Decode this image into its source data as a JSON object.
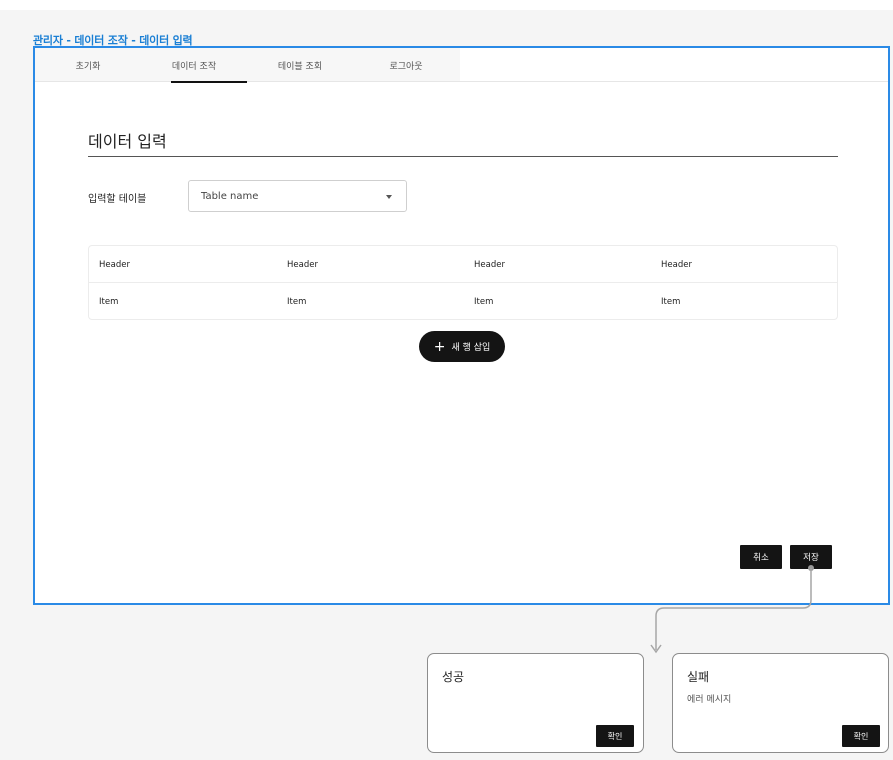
{
  "frame_title": "관리자 - 데이터 조작 - 데이터 입력",
  "tabs": [
    {
      "label": "초기화"
    },
    {
      "label": "데이터 조작"
    },
    {
      "label": "테이블 조회"
    },
    {
      "label": "로그아웃"
    }
  ],
  "active_tab": "데이터 조작",
  "page_heading": "데이터 입력",
  "table_select": {
    "label": "입력할 테이블",
    "value": "Table name"
  },
  "data_table": {
    "headers": [
      "Header",
      "Header",
      "Header",
      "Header"
    ],
    "rows": [
      [
        "Item",
        "Item",
        "Item",
        "Item"
      ]
    ]
  },
  "add_row_button": {
    "icon": "plus-icon",
    "label": "새 행 삽입"
  },
  "actions": {
    "cancel": "취소",
    "save": "저장"
  },
  "success_modal": {
    "title": "성공",
    "confirm": "확인"
  },
  "failure_modal": {
    "title": "실패",
    "message": "에러 메시지",
    "confirm": "확인"
  },
  "colors": {
    "frame_border": "#2a8ae6",
    "frame_title": "#1a7fd4",
    "button_dark": "#141414"
  }
}
